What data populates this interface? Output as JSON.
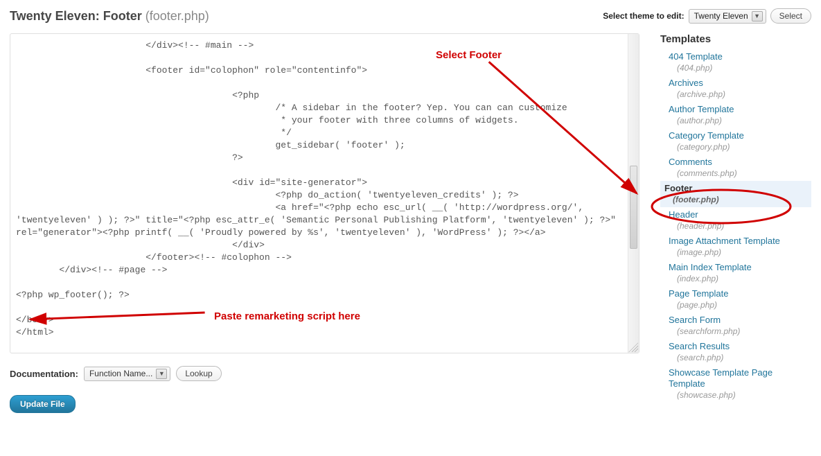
{
  "header": {
    "theme_name": "Twenty Eleven",
    "file_label": "Footer",
    "filename": "(footer.php)",
    "select_label": "Select theme to edit:",
    "dropdown_value": "Twenty Eleven",
    "select_button": "Select"
  },
  "editor": {
    "code": "\t\t\t</div><!-- #main -->\n\n\t\t\t<footer id=\"colophon\" role=\"contentinfo\">\n\n\t\t\t\t\t<?php\n\t\t\t\t\t\t/* A sidebar in the footer? Yep. You can can customize\n\t\t\t\t\t\t * your footer with three columns of widgets.\n\t\t\t\t\t\t */\n\t\t\t\t\t\tget_sidebar( 'footer' );\n\t\t\t\t\t?>\n\n\t\t\t\t\t<div id=\"site-generator\">\n\t\t\t\t\t\t<?php do_action( 'twentyeleven_credits' ); ?>\n\t\t\t\t\t\t<a href=\"<?php echo esc_url( __( 'http://wordpress.org/', 'twentyeleven' ) ); ?>\" title=\"<?php esc_attr_e( 'Semantic Personal Publishing Platform', 'twentyeleven' ); ?>\" rel=\"generator\"><?php printf( __( 'Proudly powered by %s', 'twentyeleven' ), 'WordPress' ); ?></a>\n\t\t\t\t\t</div>\n\t\t\t</footer><!-- #colophon -->\n\t</div><!-- #page -->\n\n<?php wp_footer(); ?>\n\n</body>\n</html>"
  },
  "documentation": {
    "label": "Documentation:",
    "dropdown_value": "Function Name...",
    "lookup_button": "Lookup"
  },
  "update_button": "Update File",
  "sidebar": {
    "heading": "Templates",
    "items": [
      {
        "name": "404 Template",
        "file": "(404.php)"
      },
      {
        "name": "Archives",
        "file": "(archive.php)"
      },
      {
        "name": "Author Template",
        "file": "(author.php)"
      },
      {
        "name": "Category Template",
        "file": "(category.php)"
      },
      {
        "name": "Comments",
        "file": "(comments.php)"
      },
      {
        "name": "Footer",
        "file": "(footer.php)",
        "active": true
      },
      {
        "name": "Header",
        "file": "(header.php)"
      },
      {
        "name": "Image Attachment Template",
        "file": "(image.php)"
      },
      {
        "name": "Main Index Template",
        "file": "(index.php)"
      },
      {
        "name": "Page Template",
        "file": "(page.php)"
      },
      {
        "name": "Search Form",
        "file": "(searchform.php)"
      },
      {
        "name": "Search Results",
        "file": "(search.php)"
      },
      {
        "name": "Showcase Template Page Template",
        "file": "(showcase.php)"
      }
    ]
  },
  "annotations": {
    "select_footer": "Select Footer",
    "paste_script": "Paste remarketing script here",
    "colors": {
      "annotation": "#d00000"
    }
  }
}
